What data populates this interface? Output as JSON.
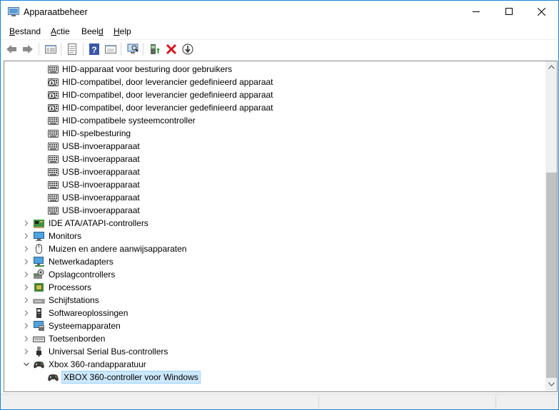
{
  "window": {
    "title": "Apparaatbeheer",
    "accent": "#1883d7"
  },
  "menu": {
    "items": [
      {
        "pre": "",
        "u": "B",
        "post": "estand"
      },
      {
        "pre": "",
        "u": "A",
        "post": "ctie"
      },
      {
        "pre": "Beel",
        "u": "d",
        "post": ""
      },
      {
        "pre": "",
        "u": "H",
        "post": "elp"
      }
    ]
  },
  "toolbar": {
    "buttons": [
      "back-icon",
      "forward-icon",
      "tree-view-icon",
      "properties-icon",
      "help-icon",
      "show-hidden-icon",
      "scan-hardware-icon",
      "update-driver-icon",
      "uninstall-icon",
      "disable-icon"
    ]
  },
  "tree": {
    "items": [
      {
        "label": "HID-apparaat voor besturing door gebruikers",
        "level": 2,
        "icon": "hid-device-icon"
      },
      {
        "label": "HID-compatibel, door leverancier gedefinieerd apparaat",
        "level": 2,
        "icon": "hid-device-disabled-icon"
      },
      {
        "label": "HID-compatibel, door leverancier gedefinieerd apparaat",
        "level": 2,
        "icon": "hid-device-disabled-icon"
      },
      {
        "label": "HID-compatibel, door leverancier gedefinieerd apparaat",
        "level": 2,
        "icon": "hid-device-disabled-icon"
      },
      {
        "label": "HID-compatibele systeemcontroller",
        "level": 2,
        "icon": "hid-device-icon"
      },
      {
        "label": "HID-spelbesturing",
        "level": 2,
        "icon": "hid-device-icon"
      },
      {
        "label": "USB-invoerapparaat",
        "level": 2,
        "icon": "hid-device-icon"
      },
      {
        "label": "USB-invoerapparaat",
        "level": 2,
        "icon": "hid-device-icon"
      },
      {
        "label": "USB-invoerapparaat",
        "level": 2,
        "icon": "hid-device-icon"
      },
      {
        "label": "USB-invoerapparaat",
        "level": 2,
        "icon": "hid-device-icon"
      },
      {
        "label": "USB-invoerapparaat",
        "level": 2,
        "icon": "hid-device-icon"
      },
      {
        "label": "USB-invoerapparaat",
        "level": 2,
        "icon": "hid-device-icon"
      },
      {
        "label": "IDE ATA/ATAPI-controllers",
        "level": 1,
        "icon": "ide-controller-icon",
        "expander": "collapsed"
      },
      {
        "label": "Monitors",
        "level": 1,
        "icon": "monitor-icon",
        "expander": "collapsed"
      },
      {
        "label": "Muizen en andere aanwijsapparaten",
        "level": 1,
        "icon": "mouse-icon",
        "expander": "collapsed"
      },
      {
        "label": "Netwerkadapters",
        "level": 1,
        "icon": "network-adapter-icon",
        "expander": "collapsed"
      },
      {
        "label": "Opslagcontrollers",
        "level": 1,
        "icon": "storage-controller-icon",
        "expander": "collapsed"
      },
      {
        "label": "Processors",
        "level": 1,
        "icon": "processor-icon",
        "expander": "collapsed"
      },
      {
        "label": "Schijfstations",
        "level": 1,
        "icon": "disk-drive-icon",
        "expander": "collapsed"
      },
      {
        "label": "Softwareoplossingen",
        "level": 1,
        "icon": "software-component-icon",
        "expander": "collapsed"
      },
      {
        "label": "Systeemapparaten",
        "level": 1,
        "icon": "system-device-icon",
        "expander": "collapsed"
      },
      {
        "label": "Toetsenborden",
        "level": 1,
        "icon": "keyboard-icon",
        "expander": "collapsed"
      },
      {
        "label": "Universal Serial Bus-controllers",
        "level": 1,
        "icon": "usb-controller-icon",
        "expander": "collapsed"
      },
      {
        "label": "Xbox 360-randapparatuur",
        "level": 1,
        "icon": "gamepad-icon",
        "expander": "expanded"
      },
      {
        "label": "XBOX 360-controller voor Windows",
        "level": 2,
        "icon": "gamepad-icon",
        "selected": true
      }
    ]
  }
}
